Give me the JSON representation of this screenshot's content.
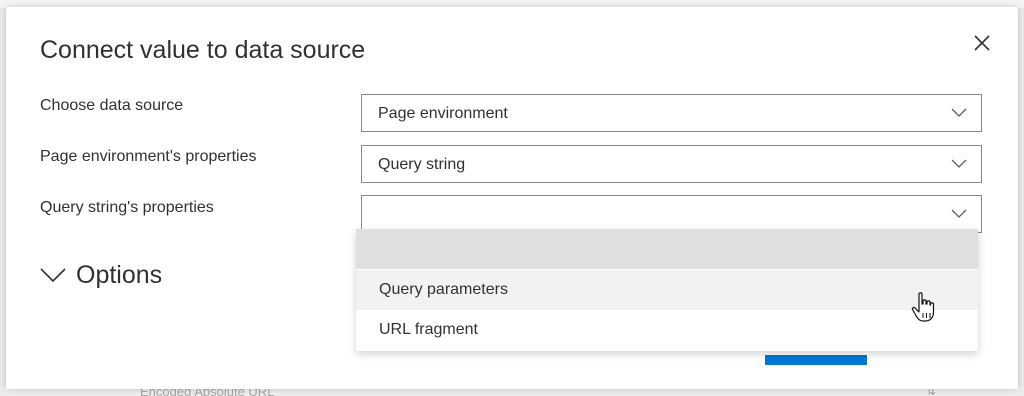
{
  "dialog": {
    "title": "Connect value to data source",
    "close_icon": "close-icon",
    "rows": [
      {
        "label": "Choose data source",
        "value": "Page environment"
      },
      {
        "label": "Page environment's properties",
        "value": "Query string"
      },
      {
        "label": "Query string's properties",
        "value": ""
      }
    ],
    "options_section": {
      "label": "Options",
      "icon": "chevron-down-icon"
    },
    "dropdown_options": [
      "",
      "Query parameters",
      "URL fragment"
    ]
  },
  "backdrop": {
    "partial_text": "Encoded Absolute URL"
  },
  "colors": {
    "accent": "#0078d4",
    "border": "#8a8886",
    "selected_option_bg": "#e1dfdd",
    "hover_option_bg": "#f3f2f1"
  }
}
